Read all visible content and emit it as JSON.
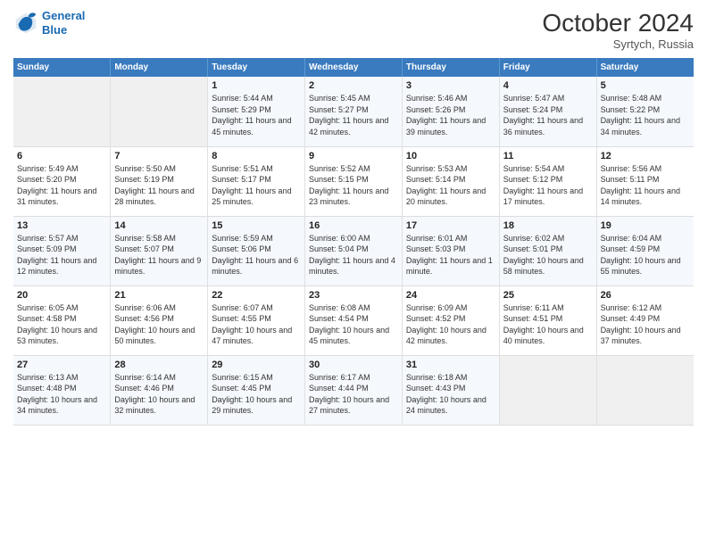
{
  "header": {
    "logo_line1": "General",
    "logo_line2": "Blue",
    "month": "October 2024",
    "location": "Syrtych, Russia"
  },
  "days_of_week": [
    "Sunday",
    "Monday",
    "Tuesday",
    "Wednesday",
    "Thursday",
    "Friday",
    "Saturday"
  ],
  "weeks": [
    [
      {
        "day": "",
        "text": ""
      },
      {
        "day": "",
        "text": ""
      },
      {
        "day": "1",
        "text": "Sunrise: 5:44 AM\nSunset: 5:29 PM\nDaylight: 11 hours and 45 minutes."
      },
      {
        "day": "2",
        "text": "Sunrise: 5:45 AM\nSunset: 5:27 PM\nDaylight: 11 hours and 42 minutes."
      },
      {
        "day": "3",
        "text": "Sunrise: 5:46 AM\nSunset: 5:26 PM\nDaylight: 11 hours and 39 minutes."
      },
      {
        "day": "4",
        "text": "Sunrise: 5:47 AM\nSunset: 5:24 PM\nDaylight: 11 hours and 36 minutes."
      },
      {
        "day": "5",
        "text": "Sunrise: 5:48 AM\nSunset: 5:22 PM\nDaylight: 11 hours and 34 minutes."
      }
    ],
    [
      {
        "day": "6",
        "text": "Sunrise: 5:49 AM\nSunset: 5:20 PM\nDaylight: 11 hours and 31 minutes."
      },
      {
        "day": "7",
        "text": "Sunrise: 5:50 AM\nSunset: 5:19 PM\nDaylight: 11 hours and 28 minutes."
      },
      {
        "day": "8",
        "text": "Sunrise: 5:51 AM\nSunset: 5:17 PM\nDaylight: 11 hours and 25 minutes."
      },
      {
        "day": "9",
        "text": "Sunrise: 5:52 AM\nSunset: 5:15 PM\nDaylight: 11 hours and 23 minutes."
      },
      {
        "day": "10",
        "text": "Sunrise: 5:53 AM\nSunset: 5:14 PM\nDaylight: 11 hours and 20 minutes."
      },
      {
        "day": "11",
        "text": "Sunrise: 5:54 AM\nSunset: 5:12 PM\nDaylight: 11 hours and 17 minutes."
      },
      {
        "day": "12",
        "text": "Sunrise: 5:56 AM\nSunset: 5:11 PM\nDaylight: 11 hours and 14 minutes."
      }
    ],
    [
      {
        "day": "13",
        "text": "Sunrise: 5:57 AM\nSunset: 5:09 PM\nDaylight: 11 hours and 12 minutes."
      },
      {
        "day": "14",
        "text": "Sunrise: 5:58 AM\nSunset: 5:07 PM\nDaylight: 11 hours and 9 minutes."
      },
      {
        "day": "15",
        "text": "Sunrise: 5:59 AM\nSunset: 5:06 PM\nDaylight: 11 hours and 6 minutes."
      },
      {
        "day": "16",
        "text": "Sunrise: 6:00 AM\nSunset: 5:04 PM\nDaylight: 11 hours and 4 minutes."
      },
      {
        "day": "17",
        "text": "Sunrise: 6:01 AM\nSunset: 5:03 PM\nDaylight: 11 hours and 1 minute."
      },
      {
        "day": "18",
        "text": "Sunrise: 6:02 AM\nSunset: 5:01 PM\nDaylight: 10 hours and 58 minutes."
      },
      {
        "day": "19",
        "text": "Sunrise: 6:04 AM\nSunset: 4:59 PM\nDaylight: 10 hours and 55 minutes."
      }
    ],
    [
      {
        "day": "20",
        "text": "Sunrise: 6:05 AM\nSunset: 4:58 PM\nDaylight: 10 hours and 53 minutes."
      },
      {
        "day": "21",
        "text": "Sunrise: 6:06 AM\nSunset: 4:56 PM\nDaylight: 10 hours and 50 minutes."
      },
      {
        "day": "22",
        "text": "Sunrise: 6:07 AM\nSunset: 4:55 PM\nDaylight: 10 hours and 47 minutes."
      },
      {
        "day": "23",
        "text": "Sunrise: 6:08 AM\nSunset: 4:54 PM\nDaylight: 10 hours and 45 minutes."
      },
      {
        "day": "24",
        "text": "Sunrise: 6:09 AM\nSunset: 4:52 PM\nDaylight: 10 hours and 42 minutes."
      },
      {
        "day": "25",
        "text": "Sunrise: 6:11 AM\nSunset: 4:51 PM\nDaylight: 10 hours and 40 minutes."
      },
      {
        "day": "26",
        "text": "Sunrise: 6:12 AM\nSunset: 4:49 PM\nDaylight: 10 hours and 37 minutes."
      }
    ],
    [
      {
        "day": "27",
        "text": "Sunrise: 6:13 AM\nSunset: 4:48 PM\nDaylight: 10 hours and 34 minutes."
      },
      {
        "day": "28",
        "text": "Sunrise: 6:14 AM\nSunset: 4:46 PM\nDaylight: 10 hours and 32 minutes."
      },
      {
        "day": "29",
        "text": "Sunrise: 6:15 AM\nSunset: 4:45 PM\nDaylight: 10 hours and 29 minutes."
      },
      {
        "day": "30",
        "text": "Sunrise: 6:17 AM\nSunset: 4:44 PM\nDaylight: 10 hours and 27 minutes."
      },
      {
        "day": "31",
        "text": "Sunrise: 6:18 AM\nSunset: 4:43 PM\nDaylight: 10 hours and 24 minutes."
      },
      {
        "day": "",
        "text": ""
      },
      {
        "day": "",
        "text": ""
      }
    ]
  ]
}
